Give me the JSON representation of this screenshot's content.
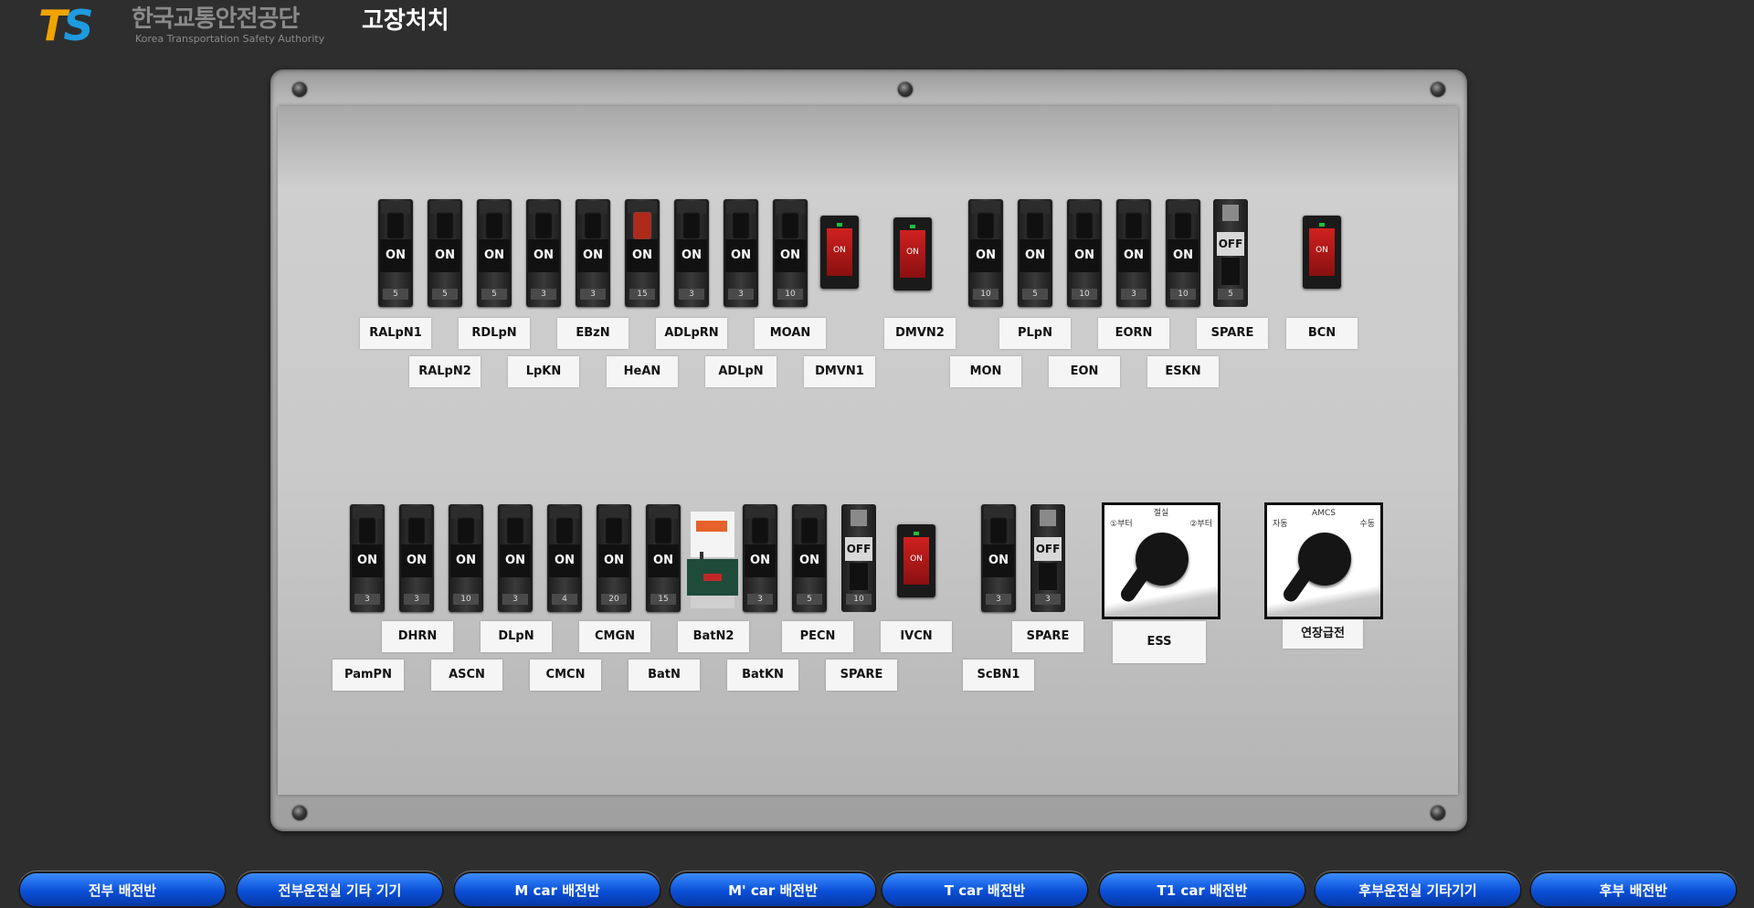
{
  "header": {
    "logo_abbr_t": "T",
    "logo_abbr_s": "S",
    "logo_korean": "한국교통안전공단",
    "logo_english": "Korea Transportation Safety Authority",
    "page_title": "고장처치"
  },
  "breakers_top": [
    {
      "state": "ON",
      "rating": "5"
    },
    {
      "state": "ON",
      "rating": "5"
    },
    {
      "state": "ON",
      "rating": "5"
    },
    {
      "state": "ON",
      "rating": "3"
    },
    {
      "state": "ON",
      "rating": "3"
    },
    {
      "state": "ON",
      "rating": "15"
    },
    {
      "state": "ON",
      "rating": "3"
    },
    {
      "state": "ON",
      "rating": "3"
    },
    {
      "state": "ON",
      "rating": "10"
    },
    {
      "state": "ON",
      "rating": "10"
    },
    {
      "state": "ON",
      "rating": "5"
    },
    {
      "state": "ON",
      "rating": "10"
    },
    {
      "state": "ON",
      "rating": "3"
    },
    {
      "state": "ON",
      "rating": "10"
    },
    {
      "state": "OFF",
      "rating": "5"
    }
  ],
  "breakers_bottom": [
    {
      "state": "ON",
      "rating": "3"
    },
    {
      "state": "ON",
      "rating": "3"
    },
    {
      "state": "ON",
      "rating": "10"
    },
    {
      "state": "ON",
      "rating": "3"
    },
    {
      "state": "ON",
      "rating": "4"
    },
    {
      "state": "ON",
      "rating": "20"
    },
    {
      "state": "ON",
      "rating": "15"
    },
    {
      "state": "ON",
      "rating": "3"
    },
    {
      "state": "ON",
      "rating": "5"
    },
    {
      "state": "OFF",
      "rating": "10"
    },
    {
      "state": "ON",
      "rating": "3"
    },
    {
      "state": "OFF",
      "rating": "3"
    }
  ],
  "rocker_label": "ON",
  "labels_top_row1": [
    "RALpN1",
    "RDLpN",
    "EBzN",
    "ADLpRN",
    "MOAN",
    "DMVN2",
    "PLpN",
    "EORN",
    "SPARE",
    "BCN"
  ],
  "labels_top_row2": [
    "RALpN2",
    "LpKN",
    "HeAN",
    "ADLpN",
    "DMVN1",
    "MON",
    "EON",
    "ESKN"
  ],
  "labels_bottom_row1": [
    "DHRN",
    "DLpN",
    "CMGN",
    "BatN2",
    "PECN",
    "IVCN",
    "SPARE",
    "ESS",
    "연장급전"
  ],
  "labels_bottom_row2": [
    "PamPN",
    "ASCN",
    "CMCN",
    "BatN",
    "BatKN",
    "SPARE",
    "ScBN1"
  ],
  "rotary_ess": {
    "caption": "절실",
    "left": "①부터",
    "right": "②부터"
  },
  "rotary_amcs": {
    "caption": "AMCS",
    "left": "자동",
    "right": "수동"
  },
  "nav_buttons": [
    "전부 배전반",
    "전부운전실 기타 기기",
    "M car 배전반",
    "M' car 배전반",
    "T car 배전반",
    "T1 car 배전반",
    "후부운전실 기타기기",
    "후부 배전반"
  ]
}
